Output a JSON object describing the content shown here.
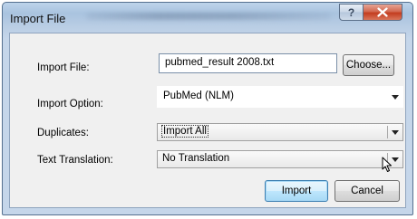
{
  "window": {
    "title": "Import File",
    "help_label": "?",
    "close_label": "✕"
  },
  "form": {
    "import_file_label": "Import File:",
    "import_file_value": "pubmed_result 2008.txt",
    "choose_label": "Choose...",
    "import_option_label": "Import Option:",
    "import_option_value": "PubMed (NLM)",
    "duplicates_label": "Duplicates:",
    "duplicates_value": "Import All",
    "text_translation_label": "Text Translation:",
    "text_translation_value": "No Translation"
  },
  "buttons": {
    "import_label": "Import",
    "cancel_label": "Cancel"
  }
}
